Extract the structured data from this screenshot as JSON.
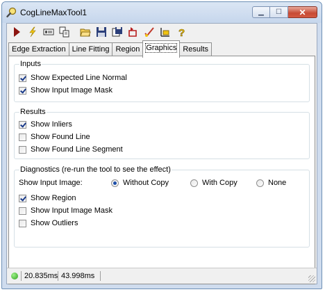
{
  "window": {
    "title": "CogLineMaxTool1"
  },
  "toolbar": {
    "buttons": [
      "run-icon",
      "electric-run-icon",
      "image-icon",
      "copy-icon",
      "open-folder-icon",
      "save-icon",
      "save-as-icon",
      "reset-icon",
      "tool-icon",
      "graph-icon",
      "help-icon"
    ]
  },
  "tabs": [
    {
      "label": "Edge Extraction",
      "active": false
    },
    {
      "label": "Line Fitting",
      "active": false
    },
    {
      "label": "Region",
      "active": false
    },
    {
      "label": "Graphics",
      "active": true
    },
    {
      "label": "Results",
      "active": false
    }
  ],
  "inputs": {
    "title": "Inputs",
    "show_expected_line_normal": {
      "label": "Show Expected Line Normal",
      "checked": true
    },
    "show_input_image_mask": {
      "label": "Show Input Image Mask",
      "checked": true
    }
  },
  "results": {
    "title": "Results",
    "show_inliers": {
      "label": "Show Inliers",
      "checked": true
    },
    "show_found_line": {
      "label": "Show Found Line",
      "checked": false
    },
    "show_found_line_segment": {
      "label": "Show Found Line Segment",
      "checked": false
    }
  },
  "diagnostics": {
    "title": "Diagnostics (re-run the tool to see the effect)",
    "show_input_image_label": "Show Input Image:",
    "radio_without_copy": {
      "label": "Without Copy",
      "selected": true
    },
    "radio_with_copy": {
      "label": "With Copy",
      "selected": false
    },
    "radio_none": {
      "label": "None",
      "selected": false
    },
    "show_region": {
      "label": "Show Region",
      "checked": true
    },
    "show_input_image_mask": {
      "label": "Show Input Image Mask",
      "checked": false
    },
    "show_outliers": {
      "label": "Show Outliers",
      "checked": false
    }
  },
  "status": {
    "time1": "20.835ms",
    "time2": "43.998ms",
    "indicator_color": "#2ea21c"
  }
}
